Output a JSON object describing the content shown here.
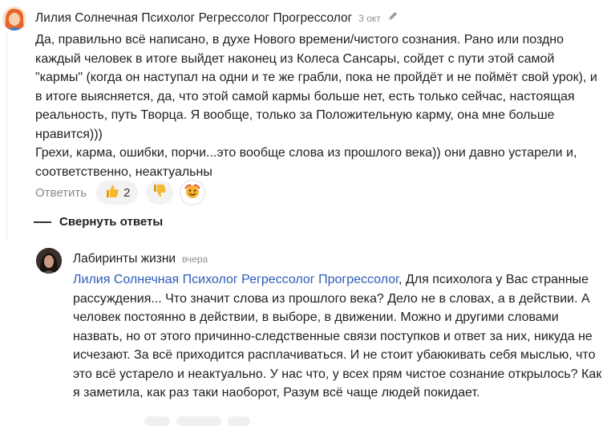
{
  "comment1": {
    "author": "Лилия Солнечная Психолог Регрессолог Прогрессолог",
    "date": "3 окт",
    "icon": "pencil-icon",
    "paragraphs": [
      "Да, правильно всё написано, в духе Нового времени/чистого сознания. Рано или поздно каждый человек в итоге выйдет наконец из Колеса Сансары, сойдет с пути этой самой \"кармы\" (когда он наступал на одни и те же грабли, пока не пройдёт и не поймёт свой урок), и в итоге выясняется, да, что этой самой кармы больше нет, есть только сейчас, настоящая реальность, путь Творца. Я вообще, только за Положительную карму, она мне больше нравится)))",
      "Грехи, карма, ошибки, порчи...это вообще слова из прошлого века)) они давно устарели и, соответственно, неактуальны"
    ],
    "reply_label": "Ответить",
    "like_count": "2"
  },
  "collapse_label": "Свернуть ответы",
  "comment2": {
    "author": "Лабиринты жизни",
    "date": "вчера",
    "mention": "Лилия Солнечная Психолог Регрессолог Прогрессолог",
    "text": ", Для психолога у Вас странные рассуждения... Что значит слова из прошлого века? Дело не в словах, а в действии. А человек постоянно в действии, в выборе, в движении. Можно и другими словами назвать, но от этого причинно-следственные связи поступков и ответ за них, никуда не исчезают. За всё приходится расплачиваться. И не стоит убаюкивать себя мыслью, что это всё устарело и неактуально. У нас что, у всех прям чистое сознание открылось? Как я заметила, как раз таки наоборот, Разум всё чаще людей покидает."
  },
  "colors": {
    "mention": "#2b5cb8",
    "muted": "#8a8a8a",
    "pill_bg": "#f2f2f2"
  }
}
